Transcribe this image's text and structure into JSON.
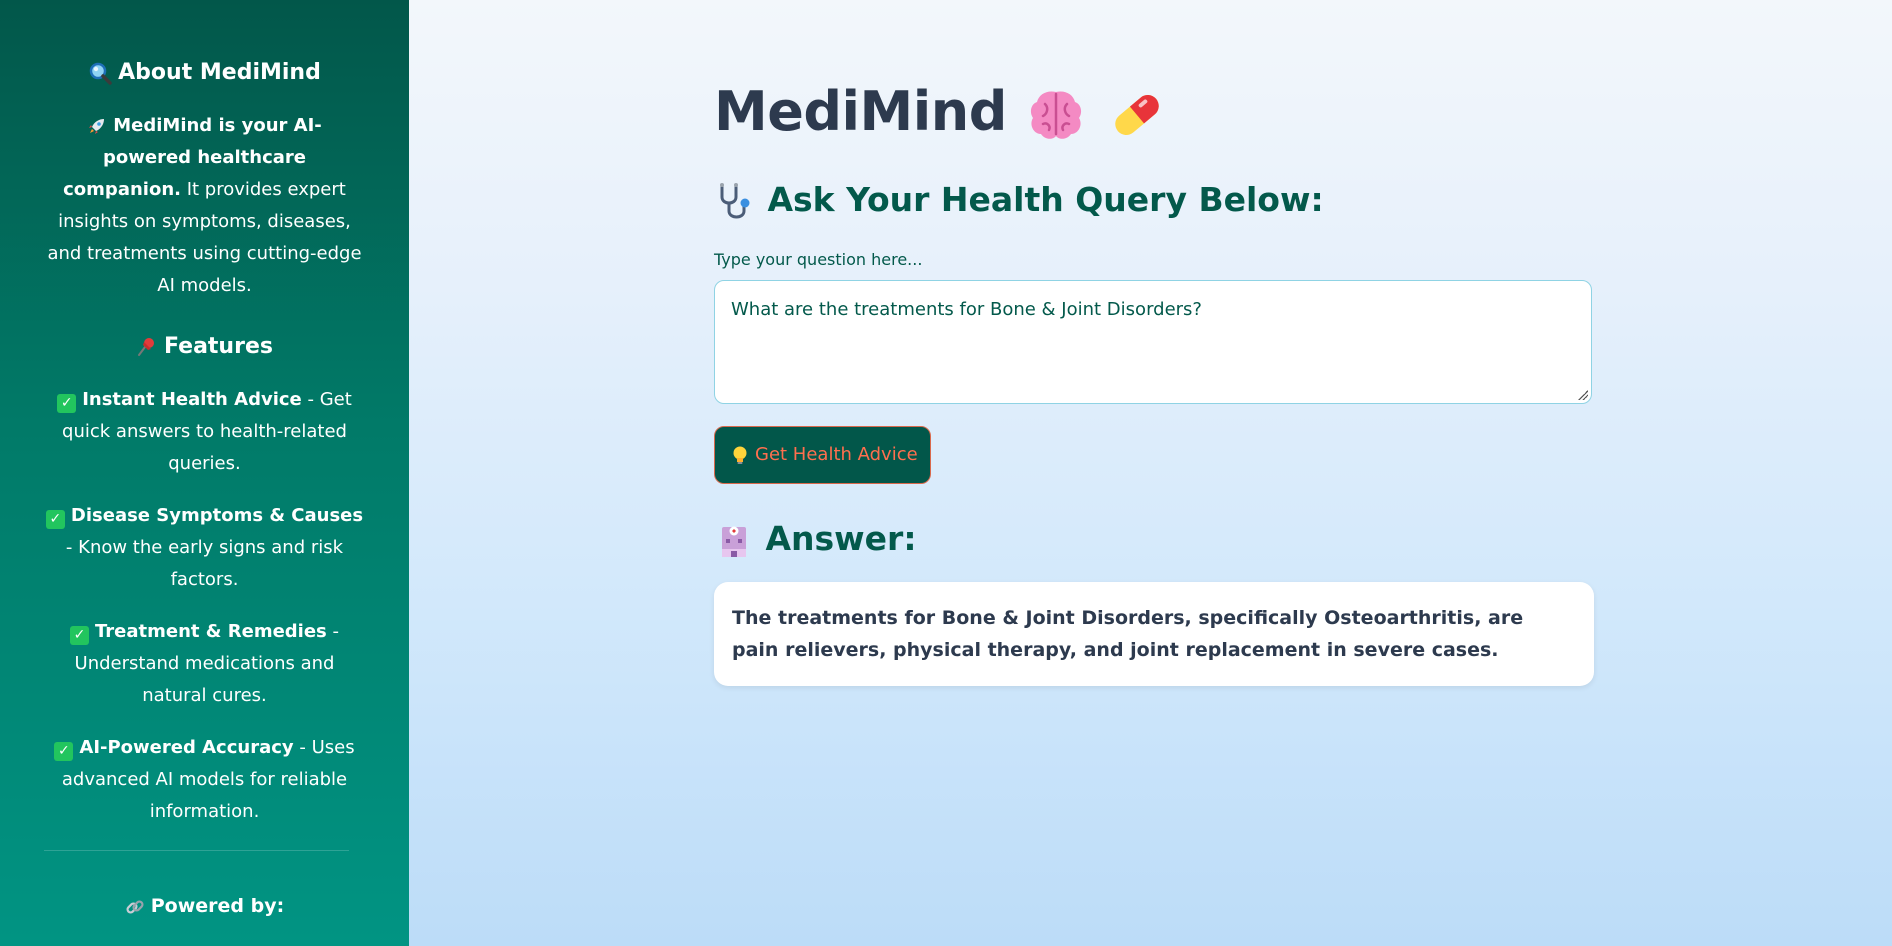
{
  "sidebar": {
    "about_heading": "About MediMind",
    "about_bold": "MediMind is your AI-powered healthcare companion.",
    "about_text": " It provides expert insights on symptoms, diseases, and treatments using cutting-edge AI models.",
    "features_heading": "Features",
    "features": [
      {
        "title": "Instant Health Advice",
        "desc": " - Get quick answers to health-related queries."
      },
      {
        "title": "Disease Symptoms & Causes",
        "desc": " - Know the early signs and risk factors."
      },
      {
        "title": "Treatment & Remedies",
        "desc": " - Understand medications and natural cures."
      },
      {
        "title": "AI-Powered Accuracy",
        "desc": " - Uses advanced AI models for reliable information."
      }
    ],
    "powered_by": "Powered by:"
  },
  "main": {
    "title": "MediMind",
    "query_heading": "Ask Your Health Query Below:",
    "input_label": "Type your question here...",
    "input_value": "What are the treatments for Bone & Joint Disorders?",
    "button_label": "Get Health Advice",
    "answer_heading": "Answer:",
    "answer_text": "The treatments for Bone & Joint Disorders, specifically Osteoarthritis, are pain relievers, physical therapy, and joint replacement in severe cases."
  },
  "colors": {
    "sidebar_top": "#02574a",
    "sidebar_bottom": "#019483",
    "heading_green": "#03594b",
    "button_text": "#ff6f4e",
    "check_green": "#22c55e"
  },
  "icons": {
    "about": "magnifier-icon",
    "rocket": "rocket-icon",
    "features": "pushpin-icon",
    "check": "check-icon",
    "link": "link-icon",
    "brain": "brain-icon",
    "pill": "pill-icon",
    "stethoscope": "stethoscope-icon",
    "bulb": "lightbulb-icon",
    "hospital": "hospital-icon"
  }
}
